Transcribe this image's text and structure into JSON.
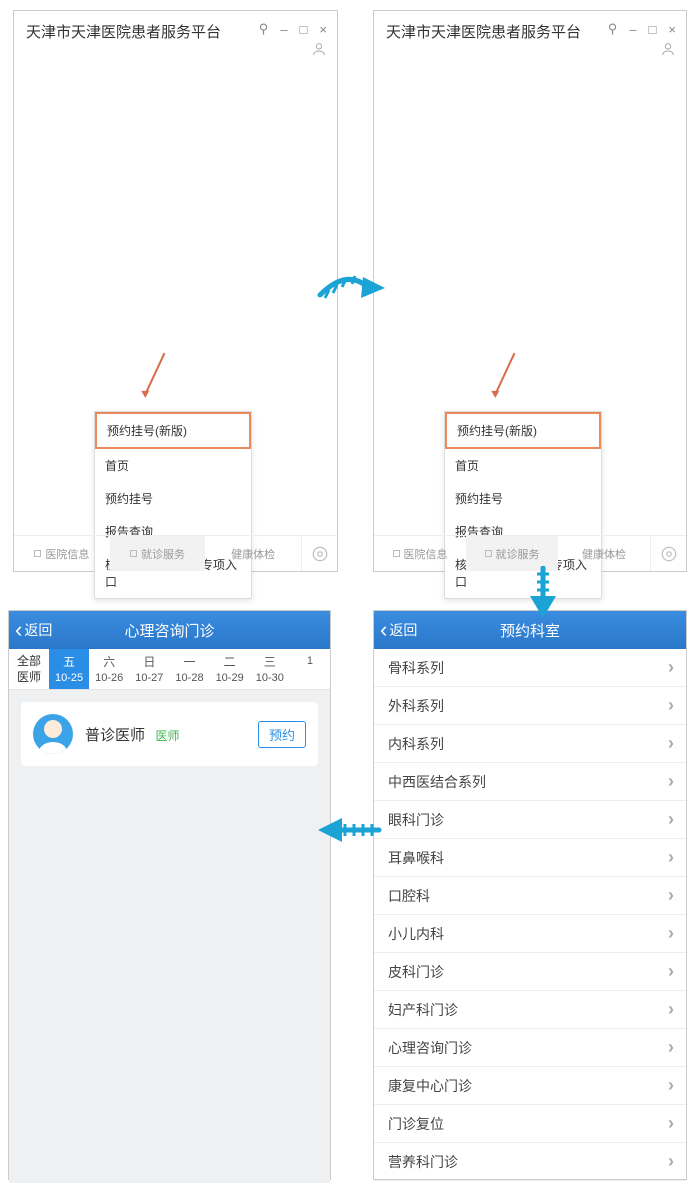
{
  "app_title": "天津市天津医院患者服务平台",
  "window_controls": {
    "pin": "⚲",
    "min": "–",
    "max": "□",
    "close": "×"
  },
  "menu": {
    "highlighted": "预约挂号(新版)",
    "items": [
      "首页",
      "预约挂号",
      "报告查询",
      "核酸检测挂号缴费专项入口"
    ]
  },
  "bottom_tabs": {
    "info": "医院信息",
    "service": "就诊服务",
    "health": "健康体检"
  },
  "dept_panel": {
    "back": "返回",
    "title": "预约科室",
    "list": [
      "骨科系列",
      "外科系列",
      "内科系列",
      "中西医结合系列",
      "眼科门诊",
      "耳鼻喉科",
      "口腔科",
      "小儿内科",
      "皮科门诊",
      "妇产科门诊",
      "心理咨询门诊",
      "康复中心门诊",
      "门诊复位",
      "营养科门诊"
    ]
  },
  "clinic_panel": {
    "back": "返回",
    "title": "心理咨询门诊",
    "col0_top": "全部",
    "col0_bot": "医师",
    "days": [
      {
        "d": "五",
        "date": "10-25",
        "sel": true
      },
      {
        "d": "六",
        "date": "10-26"
      },
      {
        "d": "日",
        "date": "10-27"
      },
      {
        "d": "一",
        "date": "10-28"
      },
      {
        "d": "二",
        "date": "10-29"
      },
      {
        "d": "三",
        "date": "10-30"
      },
      {
        "d": "",
        "date": "1"
      }
    ],
    "doctor": "普诊医师",
    "doctor_tag": "医师",
    "book": "预约"
  }
}
